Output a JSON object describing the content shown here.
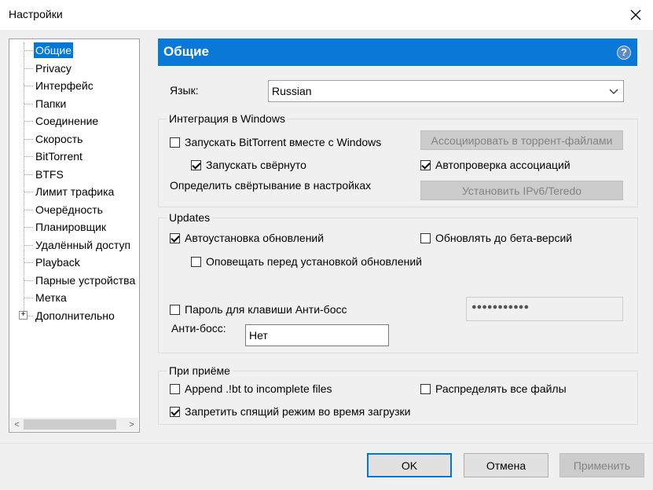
{
  "window": {
    "title": "Настройки",
    "close_icon": "close-icon"
  },
  "tree": {
    "items": [
      {
        "label": "Общие",
        "selected": true
      },
      {
        "label": "Privacy"
      },
      {
        "label": "Интерфейс"
      },
      {
        "label": "Папки"
      },
      {
        "label": "Соединение"
      },
      {
        "label": "Скорость"
      },
      {
        "label": "BitTorrent"
      },
      {
        "label": "BTFS"
      },
      {
        "label": "Лимит трафика"
      },
      {
        "label": "Очерёдность"
      },
      {
        "label": "Планировщик"
      },
      {
        "label": "Удалённый доступ"
      },
      {
        "label": "Playback"
      },
      {
        "label": "Парные устройства"
      },
      {
        "label": "Метка"
      },
      {
        "label": "Дополнительно",
        "expandable": true
      }
    ],
    "expander_glyph": "+",
    "scroll_left": "<",
    "scroll_right": ">"
  },
  "header": {
    "title": "Общие",
    "help_glyph": "?"
  },
  "language": {
    "label": "Язык:",
    "value": "Russian"
  },
  "windows_integration": {
    "title": "Интеграция в Windows",
    "start_with_windows": {
      "label": "Запускать BitTorrent вместе с Windows",
      "checked": false
    },
    "start_minimized": {
      "label": "Запускать свёрнуто",
      "checked": true
    },
    "minimize_note": "Определить свёртывание в настройках",
    "associate_button": "Ассоциировать в торрент-файлами",
    "auto_check_assoc": {
      "label": "Автопроверка ассоциаций",
      "checked": true
    },
    "ipv6_button": "Установить IPv6/Teredo"
  },
  "updates": {
    "title": "Updates",
    "auto_install": {
      "label": "Автоустановка обновлений",
      "checked": true
    },
    "beta": {
      "label": "Обновлять до бета-версий",
      "checked": false
    },
    "notify": {
      "label": "Оповещать перед установкой обновлений",
      "checked": false
    },
    "boss_password": {
      "label": "Пароль для клавиши Анти-босс",
      "checked": false
    },
    "password_value": "●●●●●●●●●●●",
    "boss_key_label": "Анти-босс:",
    "boss_key_value": "Нет"
  },
  "on_receive": {
    "title": "При приёме",
    "append_lbt": {
      "label": "Append .!bt to incomplete files",
      "checked": false
    },
    "distribute": {
      "label": "Распределять все файлы",
      "checked": false
    },
    "prevent_sleep": {
      "label": "Запретить спящий режим во время загрузки",
      "checked": true
    }
  },
  "footer": {
    "ok": "OK",
    "cancel": "Отмена",
    "apply": "Применить"
  },
  "colors": {
    "accent": "#0078d7",
    "header": "#0a78d7"
  }
}
